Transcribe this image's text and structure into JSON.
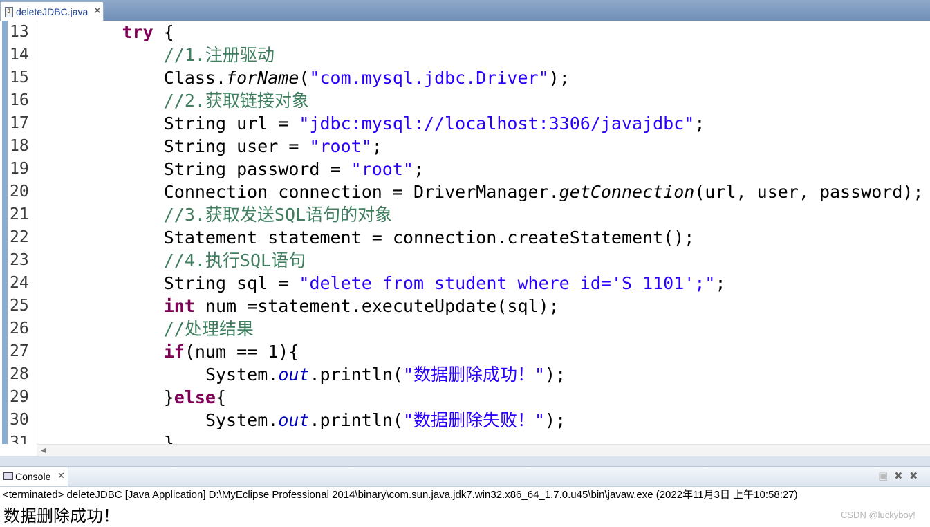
{
  "editor_tab": {
    "label": "deleteJDBC.java",
    "icon": "java-file-icon",
    "close": "✕"
  },
  "code_lines": [
    {
      "num": "13",
      "indent": 2,
      "tokens": [
        {
          "t": "try",
          "c": "kw"
        },
        {
          "t": " {"
        }
      ]
    },
    {
      "num": "14",
      "indent": 3,
      "tokens": [
        {
          "t": "//1.注册驱动",
          "c": "cm"
        }
      ]
    },
    {
      "num": "15",
      "indent": 3,
      "tokens": [
        {
          "t": "Class."
        },
        {
          "t": "forName",
          "c": "it"
        },
        {
          "t": "("
        },
        {
          "t": "\"com.mysql.jdbc.Driver\"",
          "c": "str"
        },
        {
          "t": ");"
        }
      ]
    },
    {
      "num": "16",
      "indent": 3,
      "tokens": [
        {
          "t": "//2.获取链接对象",
          "c": "cm"
        }
      ]
    },
    {
      "num": "17",
      "indent": 3,
      "tokens": [
        {
          "t": "String url = "
        },
        {
          "t": "\"jdbc:mysql://localhost:3306/javajdbc\"",
          "c": "str"
        },
        {
          "t": ";"
        }
      ]
    },
    {
      "num": "18",
      "indent": 3,
      "tokens": [
        {
          "t": "String user = "
        },
        {
          "t": "\"root\"",
          "c": "str"
        },
        {
          "t": ";"
        }
      ]
    },
    {
      "num": "19",
      "indent": 3,
      "tokens": [
        {
          "t": "String password = "
        },
        {
          "t": "\"root\"",
          "c": "str"
        },
        {
          "t": ";"
        }
      ]
    },
    {
      "num": "20",
      "indent": 3,
      "tokens": [
        {
          "t": "Connection connection = DriverManager."
        },
        {
          "t": "getConnection",
          "c": "it"
        },
        {
          "t": "(url, user, password);"
        }
      ]
    },
    {
      "num": "21",
      "indent": 3,
      "tokens": [
        {
          "t": "//3.获取发送SQL语句的对象",
          "c": "cm"
        }
      ]
    },
    {
      "num": "22",
      "indent": 3,
      "tokens": [
        {
          "t": "Statement statement = connection.createStatement();"
        }
      ]
    },
    {
      "num": "23",
      "indent": 3,
      "tokens": [
        {
          "t": "//4.执行SQL语句",
          "c": "cm"
        }
      ]
    },
    {
      "num": "24",
      "indent": 3,
      "tokens": [
        {
          "t": "String sql = "
        },
        {
          "t": "\"delete from student where id='S_1101';\"",
          "c": "str"
        },
        {
          "t": ";"
        }
      ]
    },
    {
      "num": "25",
      "indent": 3,
      "tokens": [
        {
          "t": "int",
          "c": "kw"
        },
        {
          "t": " num =statement.executeUpdate(sql);"
        }
      ]
    },
    {
      "num": "26",
      "indent": 3,
      "tokens": [
        {
          "t": "//处理结果",
          "c": "cm"
        }
      ]
    },
    {
      "num": "27",
      "indent": 3,
      "tokens": [
        {
          "t": "if",
          "c": "kw"
        },
        {
          "t": "(num == 1){"
        }
      ]
    },
    {
      "num": "28",
      "indent": 4,
      "tokens": [
        {
          "t": "System."
        },
        {
          "t": "out",
          "c": "fld"
        },
        {
          "t": ".println("
        },
        {
          "t": "\"数据删除成功！\"",
          "c": "str"
        },
        {
          "t": ");"
        }
      ]
    },
    {
      "num": "29",
      "indent": 3,
      "tokens": [
        {
          "t": "}"
        },
        {
          "t": "else",
          "c": "kw"
        },
        {
          "t": "{"
        }
      ]
    },
    {
      "num": "30",
      "indent": 4,
      "tokens": [
        {
          "t": "System."
        },
        {
          "t": "out",
          "c": "fld"
        },
        {
          "t": ".println("
        },
        {
          "t": "\"数据删除失败！\"",
          "c": "str"
        },
        {
          "t": ");"
        }
      ]
    },
    {
      "num": "31",
      "indent": 3,
      "tokens": [
        {
          "t": "}"
        }
      ]
    }
  ],
  "console": {
    "tab_label": "Console",
    "tab_icon": "console-icon",
    "tab_close": "✕",
    "toolbar_icons": [
      "clear-console-icon",
      "terminate-icon",
      "remove-all-terminated-icon"
    ],
    "status": "<terminated> deleteJDBC [Java Application] D:\\MyEclipse Professional 2014\\binary\\com.sun.java.jdk7.win32.x86_64_1.7.0.u45\\bin\\javaw.exe (2022年11月3日 上午10:58:27)",
    "output": "数据删除成功！"
  },
  "watermark": "CSDN @luckyboy!",
  "colors": {
    "keyword": "#7f0055",
    "comment": "#3f7f5f",
    "string": "#2a00ff",
    "field": "#0000c0"
  }
}
